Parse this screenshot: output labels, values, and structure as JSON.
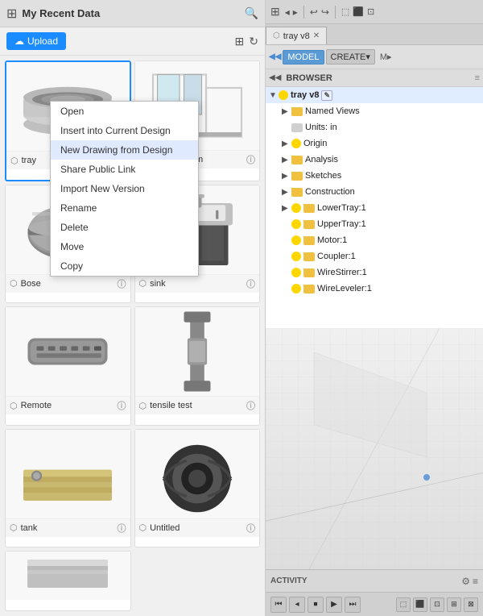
{
  "leftPanel": {
    "title": "My Recent Data",
    "uploadLabel": "Upload",
    "items": [
      {
        "id": "tray",
        "label": "tray",
        "selected": true
      },
      {
        "id": "masterRoom",
        "label": "Master Room",
        "selected": false
      },
      {
        "id": "Bose",
        "label": "Bose",
        "selected": false
      },
      {
        "id": "sink",
        "label": "sink",
        "selected": false
      },
      {
        "id": "Remote",
        "label": "Remote",
        "selected": false
      },
      {
        "id": "tensileTest",
        "label": "tensile test",
        "selected": false
      },
      {
        "id": "tank",
        "label": "tank",
        "selected": false
      },
      {
        "id": "Untitled",
        "label": "Untitled",
        "selected": false
      },
      {
        "id": "extra",
        "label": "",
        "selected": false
      }
    ]
  },
  "contextMenu": {
    "items": [
      {
        "label": "Open",
        "id": "open"
      },
      {
        "label": "Insert into Current Design",
        "id": "insert"
      },
      {
        "label": "New Drawing from Design",
        "id": "newDrawing"
      },
      {
        "label": "Share Public Link",
        "id": "share"
      },
      {
        "label": "Import New Version",
        "id": "import"
      },
      {
        "label": "Rename",
        "id": "rename"
      },
      {
        "label": "Delete",
        "id": "delete"
      },
      {
        "label": "Move",
        "id": "move"
      },
      {
        "label": "Copy",
        "id": "copy"
      }
    ]
  },
  "rightPanel": {
    "tabLabel": "tray v8",
    "modelLabel": "MODEL",
    "createLabel": "CREATE",
    "browserLabel": "BROWSER",
    "activityLabel": "ACTIVITY",
    "treeRoot": "tray v8",
    "treeItems": [
      {
        "label": "Named Views",
        "indent": 1,
        "hasArrow": false,
        "type": "folder"
      },
      {
        "label": "Units: in",
        "indent": 1,
        "hasArrow": false,
        "type": "unit"
      },
      {
        "label": "Origin",
        "indent": 1,
        "hasArrow": false,
        "type": "bulb"
      },
      {
        "label": "Analysis",
        "indent": 1,
        "hasArrow": false,
        "type": "folder"
      },
      {
        "label": "Sketches",
        "indent": 1,
        "hasArrow": false,
        "type": "folder"
      },
      {
        "label": "Construction",
        "indent": 1,
        "hasArrow": false,
        "type": "folder"
      },
      {
        "label": "LowerTray:1",
        "indent": 1,
        "hasArrow": false,
        "type": "bulb"
      },
      {
        "label": "UpperTray:1",
        "indent": 1,
        "hasArrow": false,
        "type": "bulb"
      },
      {
        "label": "Motor:1",
        "indent": 1,
        "hasArrow": false,
        "type": "bulb"
      },
      {
        "label": "Coupler:1",
        "indent": 1,
        "hasArrow": false,
        "type": "bulb"
      },
      {
        "label": "WireStirrer:1",
        "indent": 1,
        "hasArrow": false,
        "type": "bulb"
      },
      {
        "label": "WireLeveler:1",
        "indent": 1,
        "hasArrow": false,
        "type": "bulb"
      }
    ]
  }
}
